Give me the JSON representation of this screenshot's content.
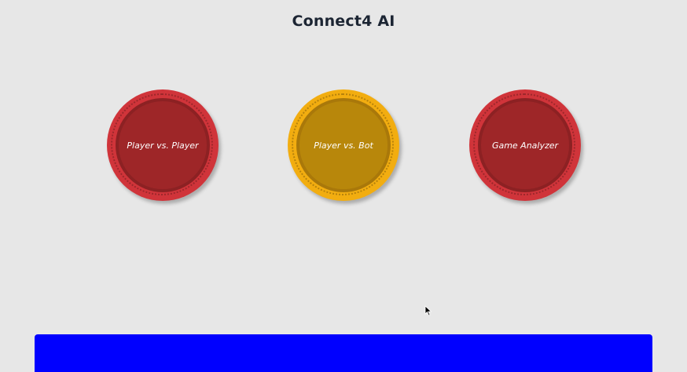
{
  "app": {
    "title": "Connect4 AI"
  },
  "modes": [
    {
      "label": "Player vs. Player",
      "color": "red"
    },
    {
      "label": "Player vs. Bot",
      "color": "yellow"
    },
    {
      "label": "Game Analyzer",
      "color": "red"
    }
  ],
  "colors": {
    "background": "#e7e7e7",
    "red_coin": "#d0343a",
    "yellow_coin": "#f2ad10",
    "bottom_bar": "#0000ff"
  },
  "icons": {
    "cursor": "mouse-pointer-icon"
  }
}
